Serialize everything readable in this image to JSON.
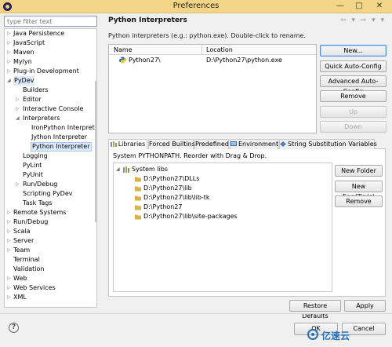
{
  "window": {
    "title": "Preferences",
    "controls": {
      "minimize": "—",
      "maximize": "□",
      "close": "✕"
    }
  },
  "filter": {
    "placeholder": "type filter text"
  },
  "tree": {
    "items": [
      {
        "label": "Java Persistence",
        "arrow": "▷"
      },
      {
        "label": "JavaScript",
        "arrow": "▷"
      },
      {
        "label": "Maven",
        "arrow": "▷"
      },
      {
        "label": "Mylyn",
        "arrow": "▷"
      },
      {
        "label": "Plug-in Development",
        "arrow": "▷"
      },
      {
        "label": "PyDev",
        "arrow": "◢"
      },
      {
        "label": "Builders",
        "arrow": ""
      },
      {
        "label": "Editor",
        "arrow": "▷"
      },
      {
        "label": "Interactive Console",
        "arrow": "▷"
      },
      {
        "label": "Interpreters",
        "arrow": "◢"
      },
      {
        "label": "IronPython Interpreter",
        "arrow": ""
      },
      {
        "label": "Jython Interpreter",
        "arrow": ""
      },
      {
        "label": "Python Interpreter",
        "arrow": ""
      },
      {
        "label": "Logging",
        "arrow": ""
      },
      {
        "label": "PyLint",
        "arrow": ""
      },
      {
        "label": "PyUnit",
        "arrow": ""
      },
      {
        "label": "Run/Debug",
        "arrow": "▷"
      },
      {
        "label": "Scripting PyDev",
        "arrow": ""
      },
      {
        "label": "Task Tags",
        "arrow": ""
      },
      {
        "label": "Remote Systems",
        "arrow": "▷"
      },
      {
        "label": "Run/Debug",
        "arrow": "▷"
      },
      {
        "label": "Scala",
        "arrow": "▷"
      },
      {
        "label": "Server",
        "arrow": "▷"
      },
      {
        "label": "Team",
        "arrow": "▷"
      },
      {
        "label": "Terminal",
        "arrow": ""
      },
      {
        "label": "Validation",
        "arrow": ""
      },
      {
        "label": "Web",
        "arrow": "▷"
      },
      {
        "label": "Web Services",
        "arrow": "▷"
      },
      {
        "label": "XML",
        "arrow": "▷"
      }
    ]
  },
  "page": {
    "title": "Python Interpreters",
    "nav": "⇦ ▾ ⇨ ▾ ▾",
    "description": "Python interpreters (e.g.: python.exe).   Double-click to rename.",
    "table": {
      "headers": [
        "Name",
        "Location"
      ],
      "rows": [
        {
          "name": "Python27\\",
          "location": "D:\\Python27\\python.exe"
        }
      ]
    },
    "buttons": {
      "new": "New...",
      "quick_auto_config": "Quick Auto-Config",
      "advanced_auto_config": "Advanced Auto-Config",
      "remove": "Remove",
      "up": "Up",
      "down": "Down"
    },
    "tabs": [
      "Libraries",
      "Forced Builtins",
      "Predefined",
      "Environment",
      "String Substitution Variables"
    ],
    "libraries": {
      "description": "System PYTHONPATH.   Reorder with Drag & Drop.",
      "root": "System libs",
      "paths": [
        "D:\\Python27\\DLLs",
        "D:\\Python27\\lib",
        "D:\\Python27\\lib\\lib-tk",
        "D:\\Python27",
        "D:\\Python27\\lib\\site-packages"
      ],
      "buttons": {
        "new_folder": "New Folder",
        "new_egg_zip": "New Egg/Zip(s)",
        "remove": "Remove"
      }
    },
    "footer": {
      "restore_defaults": "Restore Defaults",
      "apply": "Apply"
    }
  },
  "dialog_footer": {
    "help": "?",
    "ok": "OK",
    "cancel": "Cancel"
  },
  "watermark": {
    "text": "亿速云"
  },
  "colors": {
    "titlebar": "#f3d587",
    "selection": "#dcebfc",
    "focus": "#4a90d9"
  }
}
